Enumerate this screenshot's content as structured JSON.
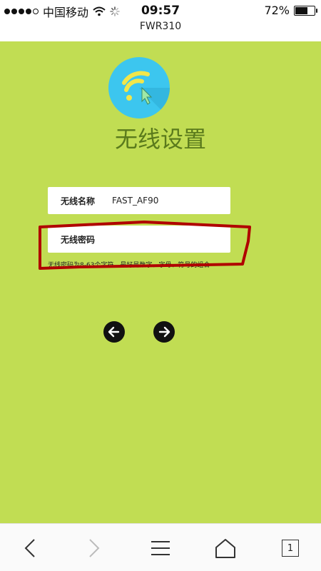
{
  "status_bar": {
    "carrier": "中国移动",
    "time": "09:57",
    "battery_text": "72%",
    "battery_level": 0.72
  },
  "page": {
    "title": "FWR310"
  },
  "main": {
    "heading": "无线设置",
    "wifi_name": {
      "label": "无线名称",
      "value": "FAST_AF90"
    },
    "wifi_password": {
      "label": "无线密码",
      "value": ""
    },
    "hint": "无线密码为8-63个字符，最好是数字、字母、符号的组合"
  },
  "icons": {
    "logo": "wifi-cursor-icon",
    "back": "arrow-left-icon",
    "next": "arrow-right-icon"
  },
  "colors": {
    "background": "#c1dd53",
    "logo": "#3cc6ef",
    "heading": "#5a7a1c",
    "annotation": "#b00000"
  },
  "toolbar": {
    "tab_count": "1"
  }
}
